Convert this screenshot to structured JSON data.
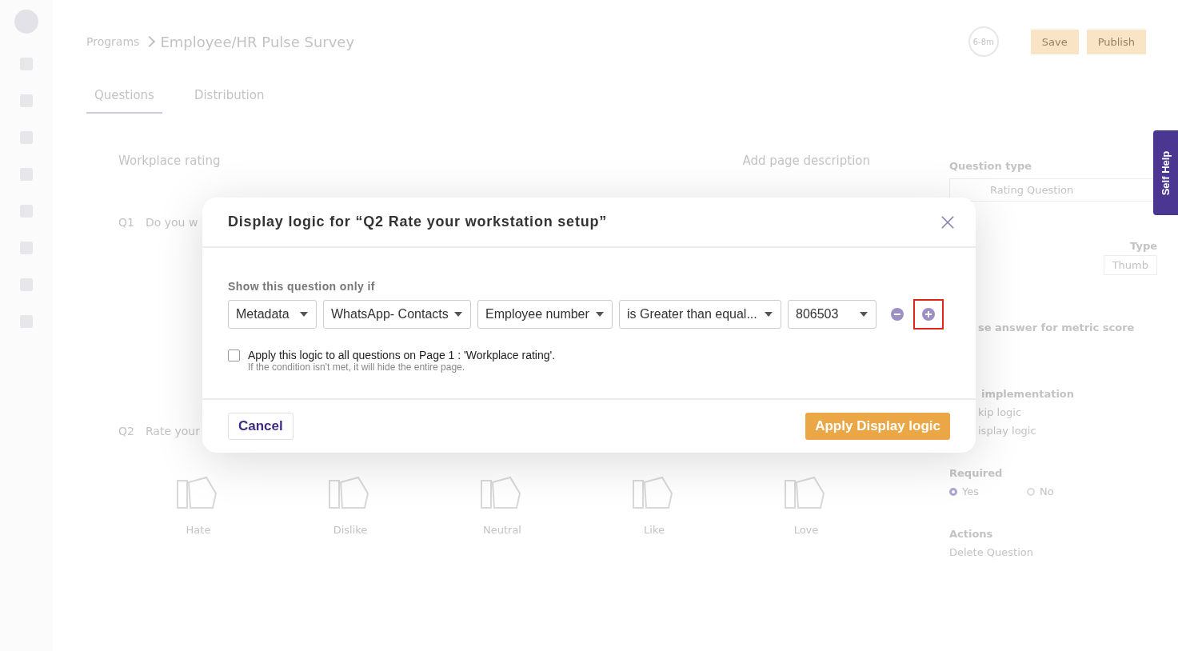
{
  "breadcrumb": {
    "parent": "Programs",
    "current": "Employee/HR Pulse Survey"
  },
  "timer": "6-8m",
  "header_buttons": [
    "Save",
    "Publish"
  ],
  "tabs": [
    {
      "label": "Questions",
      "selected": true
    },
    {
      "label": "Distribution",
      "selected": false
    }
  ],
  "page": {
    "title": "Workplace rating",
    "add_description": "Add page description"
  },
  "questions": [
    {
      "number": "Q1",
      "text": "Do you w"
    },
    {
      "number": "Q2",
      "text": "Rate your"
    }
  ],
  "rating_options": [
    "Hate",
    "Dislike",
    "Neutral",
    "Like",
    "Love"
  ],
  "side_panel": {
    "question_type_label": "Question type",
    "question_type": "Rating Question",
    "type_label": "Type",
    "type_value": "Thumb",
    "metric_label": "se answer for metric score",
    "implementation_label": "implementation",
    "logic_items": [
      "kip logic",
      "isplay logic"
    ],
    "required_label": "Required",
    "required_options": [
      {
        "label": "Yes",
        "selected": true
      },
      {
        "label": "No",
        "selected": false
      }
    ],
    "actions_label": "Actions",
    "delete_action": "Delete Question"
  },
  "self_help": "Self Help",
  "dialog": {
    "title": "Display logic for “Q2 Rate your workstation setup”",
    "condition_label": "Show this question only if",
    "conditions": [
      {
        "value": "Metadata"
      },
      {
        "value": "WhatsApp- Contacts"
      },
      {
        "value": "Employee number"
      },
      {
        "value": "is Greater than equal..."
      },
      {
        "value": "806503"
      }
    ],
    "apply_all": {
      "label": "Apply this logic to all questions on Page 1 : 'Workplace rating'.",
      "hint": "If the condition isn't met, it will hide the entire page.",
      "checked": false
    },
    "highlight_add": true,
    "cancel": "Cancel",
    "apply": "Apply Display logic"
  }
}
